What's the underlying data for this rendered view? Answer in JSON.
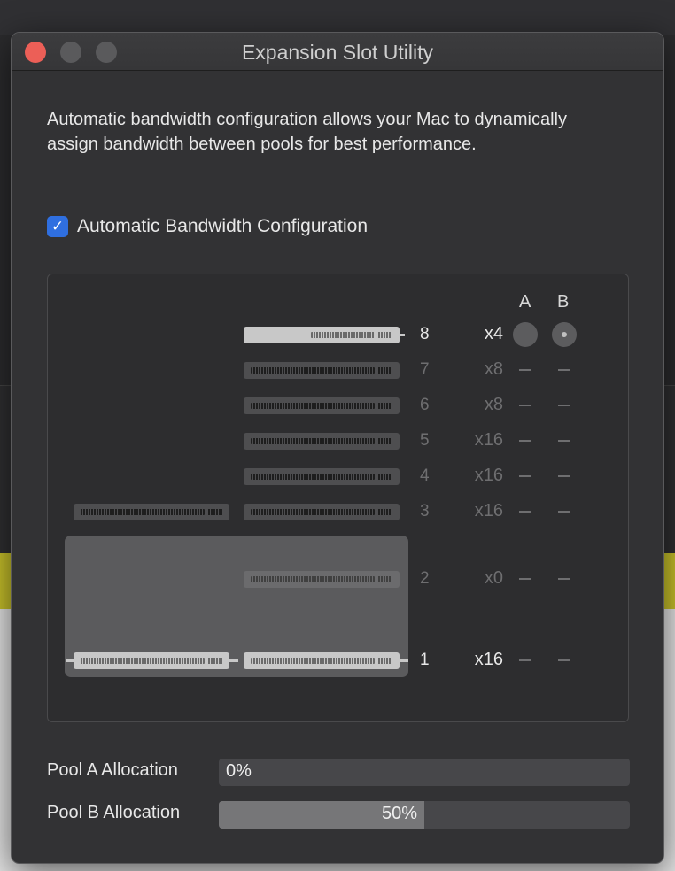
{
  "window": {
    "title": "Expansion Slot Utility"
  },
  "description": "Automatic bandwidth configuration allows your Mac to dynamically assign bandwidth between pools for best performance.",
  "auto_config": {
    "label": "Automatic Bandwidth Configuration",
    "checked": true
  },
  "columns": {
    "a": "A",
    "b": "B"
  },
  "slots": [
    {
      "number": "8",
      "bandwidth": "x4",
      "active": true,
      "pool_a": "radio",
      "pool_b": "radio-selected"
    },
    {
      "number": "7",
      "bandwidth": "x8",
      "active": false,
      "pool_a": "—",
      "pool_b": "—"
    },
    {
      "number": "6",
      "bandwidth": "x8",
      "active": false,
      "pool_a": "—",
      "pool_b": "—"
    },
    {
      "number": "5",
      "bandwidth": "x16",
      "active": false,
      "pool_a": "—",
      "pool_b": "—"
    },
    {
      "number": "4",
      "bandwidth": "x16",
      "active": false,
      "pool_a": "—",
      "pool_b": "—"
    },
    {
      "number": "3",
      "bandwidth": "x16",
      "active": false,
      "pool_a": "—",
      "pool_b": "—"
    },
    {
      "number": "2",
      "bandwidth": "x0",
      "active": false,
      "pool_a": "—",
      "pool_b": "—"
    },
    {
      "number": "1",
      "bandwidth": "x16",
      "active": true,
      "pool_a": "—",
      "pool_b": "—"
    }
  ],
  "allocation": {
    "pool_a": {
      "label": "Pool A Allocation",
      "value_text": "0%",
      "fraction": 0.0
    },
    "pool_b": {
      "label": "Pool B Allocation",
      "value_text": "50%",
      "fraction": 0.5
    }
  },
  "colors": {
    "checkbox": "#2f6fe0",
    "close_button": "#ec5f57"
  }
}
